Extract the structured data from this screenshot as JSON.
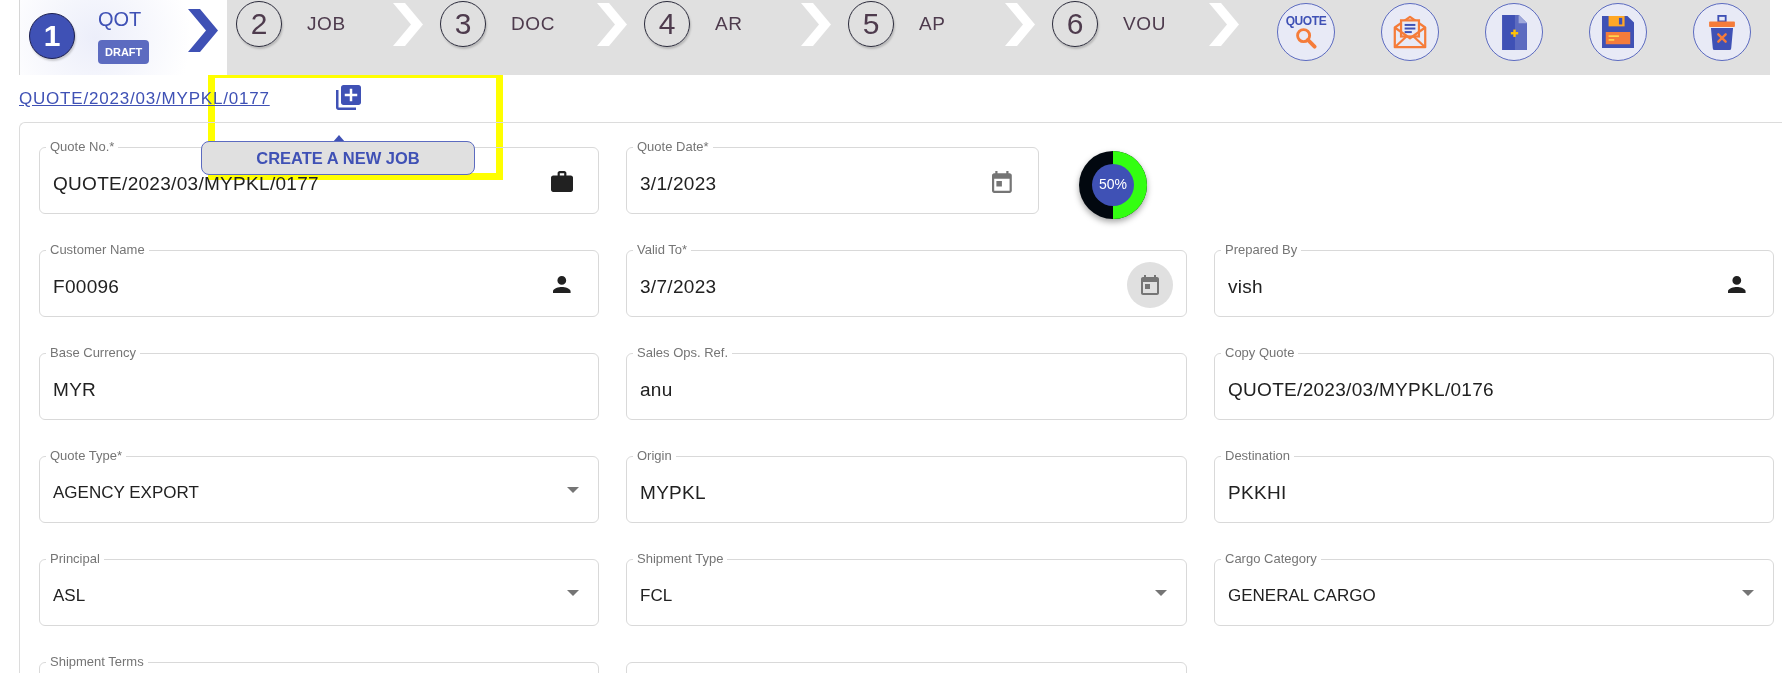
{
  "steps": [
    {
      "number": "1",
      "label": "QOT",
      "badge": "DRAFT",
      "selected": true
    },
    {
      "number": "2",
      "label": "JOB",
      "selected": false
    },
    {
      "number": "3",
      "label": "DOC",
      "selected": false
    },
    {
      "number": "4",
      "label": "AR",
      "selected": false
    },
    {
      "number": "5",
      "label": "AP",
      "selected": false
    },
    {
      "number": "6",
      "label": "VOU",
      "selected": false
    }
  ],
  "actions": [
    {
      "kind": "quote-search",
      "text": "QUOTE"
    },
    {
      "kind": "mail"
    },
    {
      "kind": "new-document"
    },
    {
      "kind": "save"
    },
    {
      "kind": "delete"
    }
  ],
  "quote_link": {
    "text": "QUOTE/2023/03/MYPKL/0177",
    "tooltip": "CREATE A NEW JOB"
  },
  "highlight_frame": true,
  "form": {
    "rows": [
      [
        {
          "kind": "text",
          "label": "Quote No.*",
          "value": "QUOTE/2023/03/MYPKL/0177",
          "icon": {
            "kind": "briefcase",
            "hovered": false
          }
        },
        {
          "kind": "date",
          "label": "Quote Date*",
          "value": "3/1/2023",
          "icon": {
            "kind": "calendar",
            "hovered": false
          }
        },
        {
          "kind": "progress",
          "level": 0.5,
          "label": "50%"
        }
      ],
      [
        {
          "kind": "text",
          "label": "Customer Name",
          "value": "F00096",
          "icon": {
            "kind": "person",
            "hovered": false
          }
        },
        {
          "kind": "date",
          "label": "Valid To*",
          "value": "3/7/2023",
          "icon": {
            "kind": "calendar",
            "hovered": true
          }
        },
        {
          "kind": "text",
          "label": "Prepared By",
          "value": "vish",
          "icon": {
            "kind": "person",
            "hovered": false
          }
        }
      ],
      [
        {
          "kind": "text",
          "label": "Base Currency",
          "value": "MYR"
        },
        {
          "kind": "text",
          "label": "Sales Ops. Ref.",
          "value": "anu"
        },
        {
          "kind": "text",
          "label": "Copy Quote",
          "value": "QUOTE/2023/03/MYPKL/0176"
        }
      ],
      [
        {
          "kind": "select",
          "label": "Quote Type*",
          "value": "AGENCY EXPORT"
        },
        {
          "kind": "text",
          "label": "Origin",
          "value": "MYPKL"
        },
        {
          "kind": "text",
          "label": "Destination",
          "value": "PKKHI"
        }
      ],
      [
        {
          "kind": "select",
          "label": "Principal",
          "value": "ASL"
        },
        {
          "kind": "select",
          "label": "Shipment Type",
          "value": "FCL"
        },
        {
          "kind": "select",
          "label": "Cargo Category",
          "value": "GENERAL CARGO"
        }
      ],
      [
        {
          "kind": "text",
          "label": "Shipment Terms"
        },
        {
          "kind": "text"
        }
      ]
    ]
  }
}
